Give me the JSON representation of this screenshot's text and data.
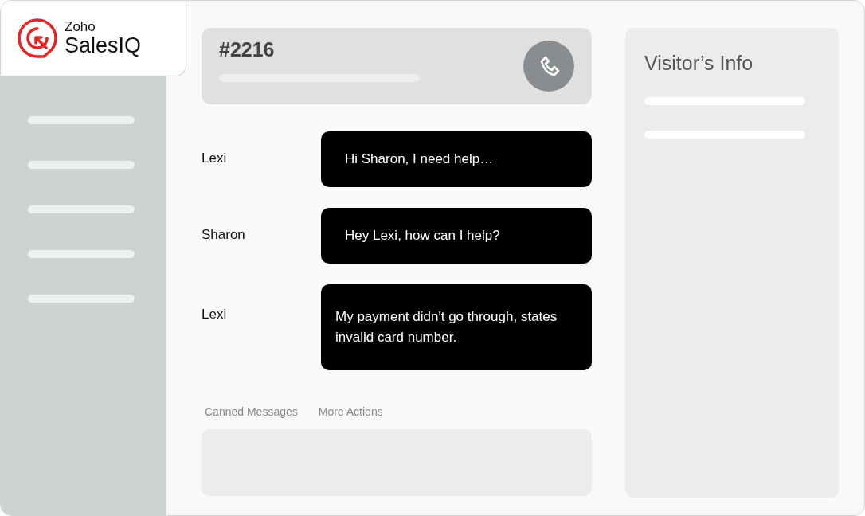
{
  "app": {
    "brand": "Zoho",
    "product": "SalesIQ"
  },
  "chat": {
    "ticket": "#2216"
  },
  "messages": [
    {
      "sender": "Lexi",
      "text": "Hi Sharon, I need help…"
    },
    {
      "sender": "Sharon",
      "text": "Hey Lexi, how can I help?"
    },
    {
      "sender": "Lexi",
      "text": "My payment didn't go through, states invalid card number."
    }
  ],
  "actions": [
    {
      "label": "Canned Messages"
    },
    {
      "label": "More Actions"
    }
  ],
  "visitor_panel": {
    "title": "Visitor’s Info"
  }
}
